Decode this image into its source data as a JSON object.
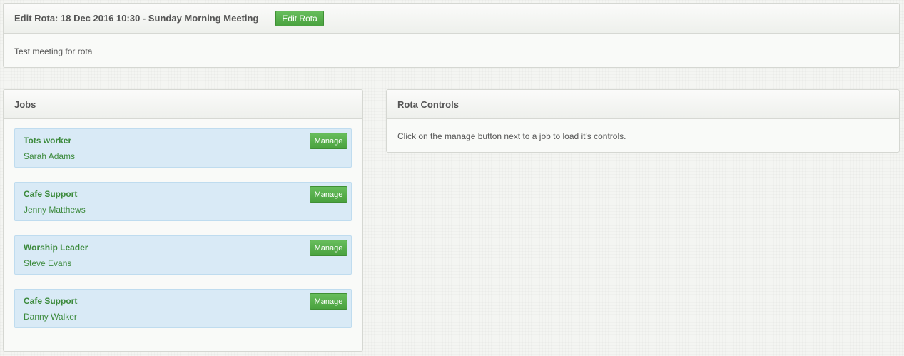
{
  "header": {
    "title": "Edit Rota: 18 Dec 2016 10:30 - Sunday Morning Meeting",
    "edit_button": "Edit Rota",
    "description": "Test meeting for rota"
  },
  "jobs_panel": {
    "title": "Jobs",
    "jobs": [
      {
        "title": "Tots worker",
        "person": "Sarah Adams",
        "button": "Manage"
      },
      {
        "title": "Cafe Support",
        "person": "Jenny Matthews",
        "button": "Manage"
      },
      {
        "title": "Worship Leader",
        "person": "Steve Evans",
        "button": "Manage"
      },
      {
        "title": "Cafe Support",
        "person": "Danny Walker",
        "button": "Manage"
      }
    ]
  },
  "controls_panel": {
    "title": "Rota Controls",
    "description": "Click on the manage button next to a job to load it's controls."
  },
  "colors": {
    "button_green": "#4aa23f",
    "job_background": "#d9eaf6",
    "job_text": "#3c8a3c"
  }
}
